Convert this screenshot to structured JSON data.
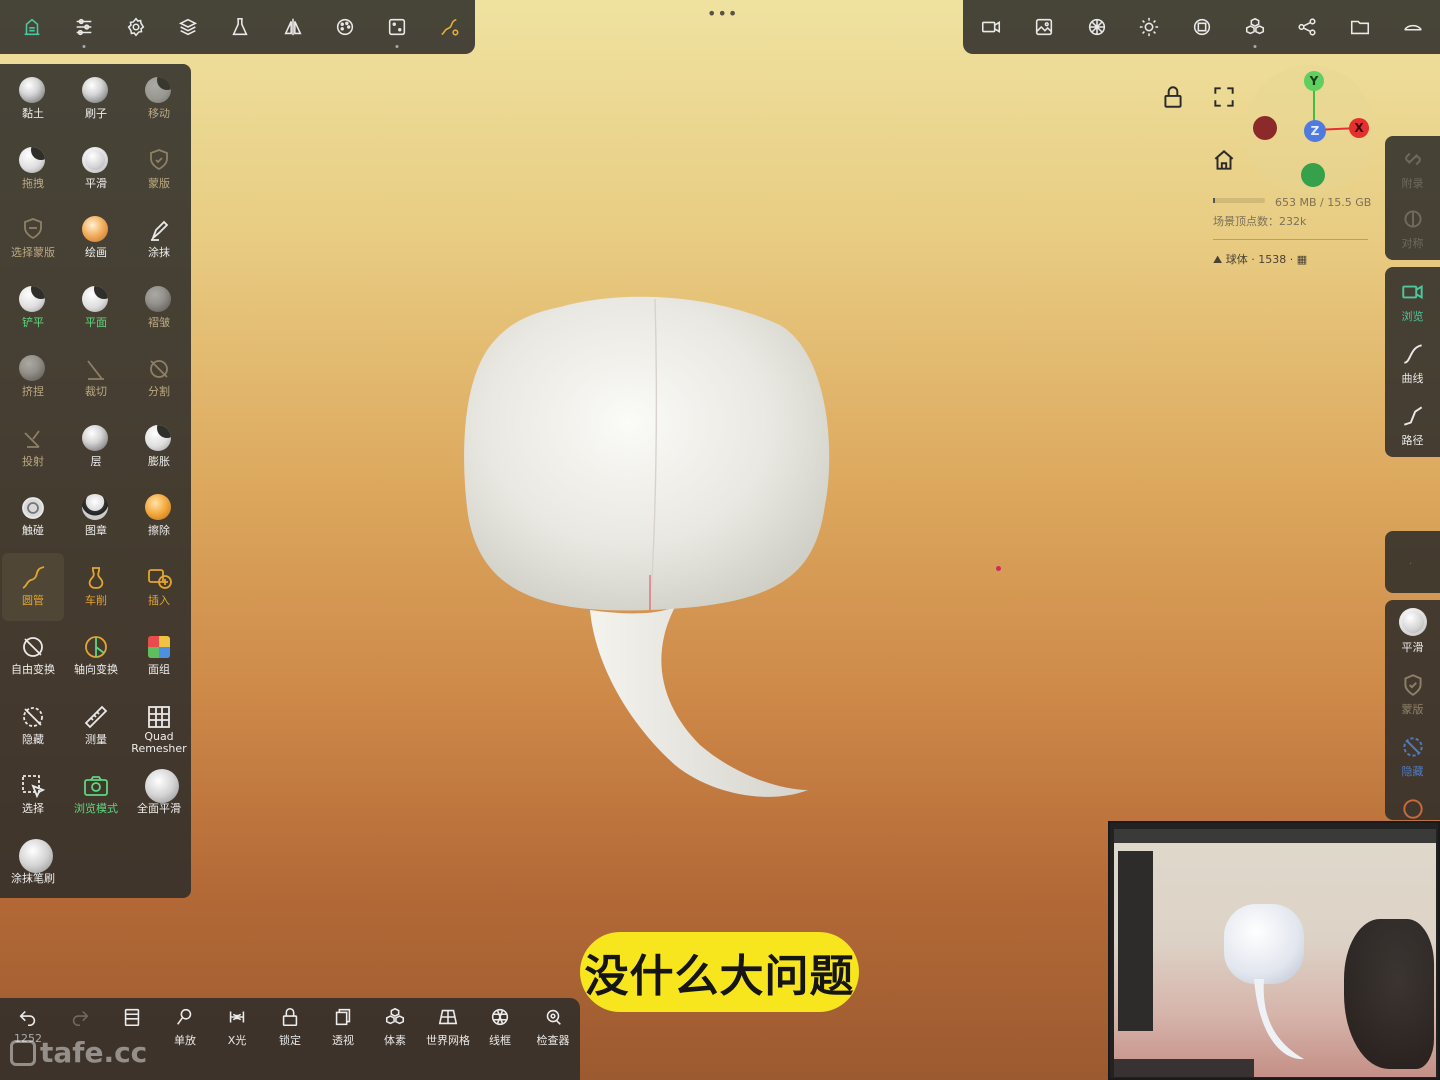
{
  "top_left_toolbar": {
    "icons": [
      "nomad-logo-icon",
      "sliders-icon",
      "gear-icon",
      "layers-icon",
      "flask-icon",
      "symmetry-icon",
      "palette-icon",
      "dice-icon",
      "tube-tool-icon"
    ]
  },
  "top_right_toolbar": {
    "icons": [
      "camera-icon",
      "image-icon",
      "shading-icon",
      "light-icon",
      "matcap-icon",
      "cubes-icon",
      "share-icon",
      "folder-icon",
      "hide-toolbar-icon"
    ]
  },
  "tools": [
    {
      "label": "黏土",
      "style": "white"
    },
    {
      "label": "刷子",
      "style": "white"
    },
    {
      "label": "移动",
      "style": "dim"
    },
    {
      "label": "拖拽",
      "style": "dim"
    },
    {
      "label": "平滑",
      "style": "white"
    },
    {
      "label": "蒙版",
      "style": "dim"
    },
    {
      "label": "选择蒙版",
      "style": "dim"
    },
    {
      "label": "绘画",
      "style": "white"
    },
    {
      "label": "涂抹",
      "style": "white"
    },
    {
      "label": "铲平",
      "style": "green"
    },
    {
      "label": "平面",
      "style": "green"
    },
    {
      "label": "褶皱",
      "style": "dim"
    },
    {
      "label": "挤捏",
      "style": "dim"
    },
    {
      "label": "裁切",
      "style": "dim"
    },
    {
      "label": "分割",
      "style": "dim"
    },
    {
      "label": "投射",
      "style": "dim"
    },
    {
      "label": "层",
      "style": "white"
    },
    {
      "label": "膨胀",
      "style": "white"
    },
    {
      "label": "触碰",
      "style": "white"
    },
    {
      "label": "图章",
      "style": "white"
    },
    {
      "label": "擦除",
      "style": "white"
    },
    {
      "label": "圆管",
      "style": "gold"
    },
    {
      "label": "车削",
      "style": "gold"
    },
    {
      "label": "插入",
      "style": "gold"
    },
    {
      "label": "自由变换",
      "style": "white"
    },
    {
      "label": "轴向变换",
      "style": "white"
    },
    {
      "label": "面组",
      "style": "white"
    },
    {
      "label": "隐藏",
      "style": "white"
    },
    {
      "label": "测量",
      "style": "white"
    },
    {
      "label": "Quad Remesher",
      "style": "white"
    },
    {
      "label": "选择",
      "style": "white"
    },
    {
      "label": "浏览模式",
      "style": "green"
    },
    {
      "label": "全面平滑",
      "style": "white"
    },
    {
      "label": "涂抹笔刷",
      "style": "white"
    }
  ],
  "info": {
    "memory": "653 MB / 15.5 GB",
    "memory_fraction": 0.04,
    "vertices": "场景顶点数：232k",
    "object": "球体 · 1538 ·"
  },
  "gizmo": {
    "x_label": "X",
    "y_label": "Y",
    "z_label": "Z",
    "x_color": "#e53030",
    "y_color": "#3fbf3f",
    "z_color": "#4f7be0"
  },
  "right_panel": {
    "top_items": [
      "附录",
      "对称"
    ],
    "mode_items": [
      "浏览",
      "曲线",
      "路径"
    ],
    "tool_items": [
      "平滑",
      "蒙版",
      "隐藏"
    ]
  },
  "bottom_toolbar": {
    "undo_count": "1252",
    "buttons": [
      "单放",
      "X光",
      "锁定",
      "透视",
      "体素",
      "世界网格",
      "线框",
      "检查器"
    ]
  },
  "subtitle": "没什么大问题",
  "watermark": "tafe.cc"
}
